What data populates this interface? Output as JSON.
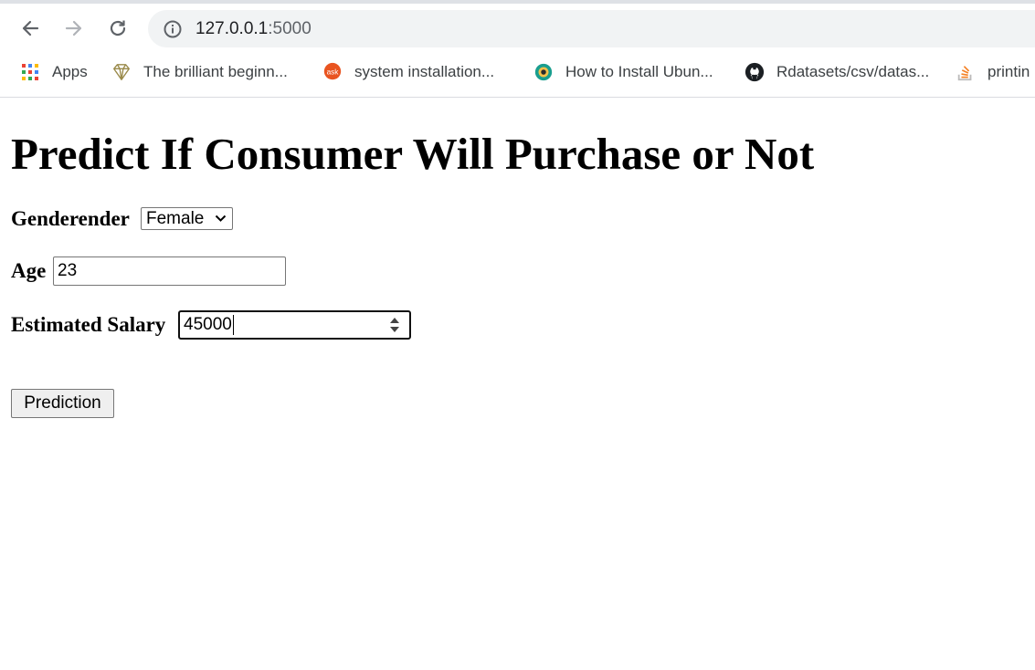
{
  "browser": {
    "url_host": "127.0.0.1",
    "url_port": ":5000"
  },
  "bookmarks": [
    {
      "label": "Apps",
      "icon": "apps-grid-icon"
    },
    {
      "label": "The brilliant beginn...",
      "icon": "diamond-icon"
    },
    {
      "label": "system installation...",
      "icon": "askubuntu-icon"
    },
    {
      "label": "How to Install Ubun...",
      "icon": "gear-icon"
    },
    {
      "label": "Rdatasets/csv/datas...",
      "icon": "github-icon"
    },
    {
      "label": "printin",
      "icon": "stackoverflow-icon"
    }
  ],
  "page": {
    "title": "Predict If Consumer Will Purchase or Not",
    "gender_label": "Genderender",
    "gender_value": "Female",
    "age_label": "Age",
    "age_value": "23",
    "salary_label": "Estimated Salary",
    "salary_value": "45000",
    "submit_label": "Prediction"
  }
}
